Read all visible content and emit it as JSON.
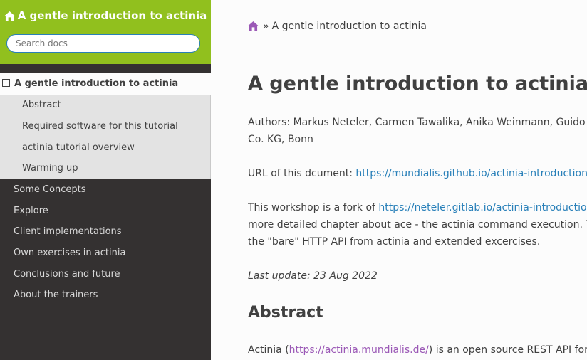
{
  "sidebar": {
    "brand_title": "A gentle introduction to actinia",
    "search_placeholder": "Search docs",
    "current_page": "A gentle introduction to actinia",
    "sub_items": [
      "Abstract",
      "Required software for this tutorial",
      "actinia tutorial overview",
      "Warming up"
    ],
    "items": [
      "Some Concepts",
      "Explore",
      "Client implementations",
      "Own exercises in actinia",
      "Conclusions and future",
      "About the trainers"
    ]
  },
  "breadcrumb": {
    "separator": "»",
    "current": "A gentle introduction to actinia"
  },
  "main": {
    "title": "A gentle introduction to actinia",
    "authors_line1": "Authors: Markus Neteler, Carmen Tawalika, Anika Weinmann, Guido",
    "authors_line2": "Co. KG, Bonn",
    "url_label": "URL of this dcument: ",
    "url_link": "https://mundialis.github.io/actinia-introduction",
    "fork_prefix": "This workshop is a fork of ",
    "fork_link": "https://neteler.gitlab.io/actinia-introductio",
    "fork_line2": "more detailed chapter about ace - the actinia command execution. T",
    "fork_line3": "the \"bare\" HTTP API from actinia and extended excercises.",
    "last_update": "Last update: 23 Aug 2022",
    "abstract_heading": "Abstract",
    "abstract_prefix": "Actinia (",
    "abstract_link": "https://actinia.mundialis.de/",
    "abstract_suffix": ") is an open source REST API for"
  },
  "colors": {
    "brand": "#91c01e",
    "sidebar_bg": "#343131",
    "link": "#2980b9",
    "visited_link": "#9b59b6",
    "home_icon": "#9b59b6"
  }
}
